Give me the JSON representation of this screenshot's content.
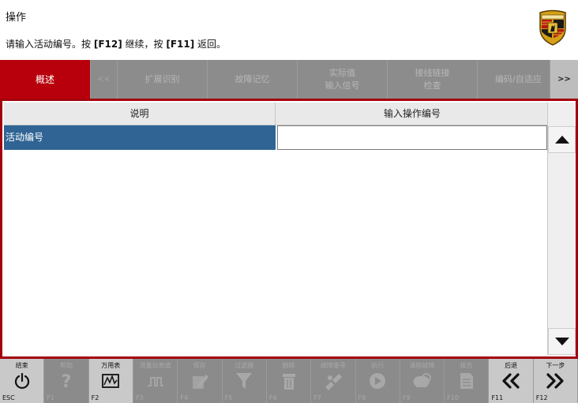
{
  "header": {
    "title": "操作",
    "instruction_prefix": "请输入活动编号。按 ",
    "key_continue": "[F12]",
    "instruction_mid": " 继续，按 ",
    "key_back": "[F11]",
    "instruction_suffix": " 返回。"
  },
  "tabs": {
    "overview": "概述",
    "prev_arrow": "<<",
    "extended_id": "扩展识别",
    "fault_memory": "故障记忆",
    "actual_values_line1": "实际值",
    "actual_values_line2": "输入信号",
    "wiring_check_line1": "接线链接",
    "wiring_check_line2": "检查",
    "coding_adaptation": "编码/自适应",
    "more_arrow": ">>"
  },
  "table": {
    "col_description": "说明",
    "col_input": "输入操作编号",
    "rows": [
      {
        "label": "活动编号",
        "value": ""
      }
    ]
  },
  "toolbar": {
    "keys": [
      {
        "label": "结束",
        "key": "ESC",
        "icon": "power-icon",
        "enabled": true
      },
      {
        "label": "帮助",
        "key": "F1",
        "icon": "help-icon",
        "enabled": false
      },
      {
        "label": "万用表",
        "key": "F2",
        "icon": "multimeter-icon",
        "enabled": true
      },
      {
        "label": "测量仪表值",
        "key": "F3",
        "icon": "oscilloscope-icon",
        "enabled": false
      },
      {
        "label": "保存",
        "key": "F4",
        "icon": "edit-icon",
        "enabled": false
      },
      {
        "label": "过滤器",
        "key": "F5",
        "icon": "filter-icon",
        "enabled": false
      },
      {
        "label": "删除",
        "key": "F6",
        "icon": "trash-icon",
        "enabled": false
      },
      {
        "label": "故障查寻",
        "key": "F7",
        "icon": "diagnose-icon",
        "enabled": false
      },
      {
        "label": "执行",
        "key": "F8",
        "icon": "play-icon",
        "enabled": false
      },
      {
        "label": "清除故障",
        "key": "F9",
        "icon": "clear-fault-icon",
        "enabled": false
      },
      {
        "label": "报告",
        "key": "F10",
        "icon": "report-icon",
        "enabled": false
      },
      {
        "label": "后退",
        "key": "F11",
        "icon": "back-icon",
        "enabled": true
      },
      {
        "label": "下一步",
        "key": "F12",
        "icon": "next-icon",
        "enabled": true
      }
    ]
  },
  "colors": {
    "accent_red": "#b8000c",
    "selection_blue": "#2f6494",
    "toolbar_gray": "#8a8a8a"
  }
}
